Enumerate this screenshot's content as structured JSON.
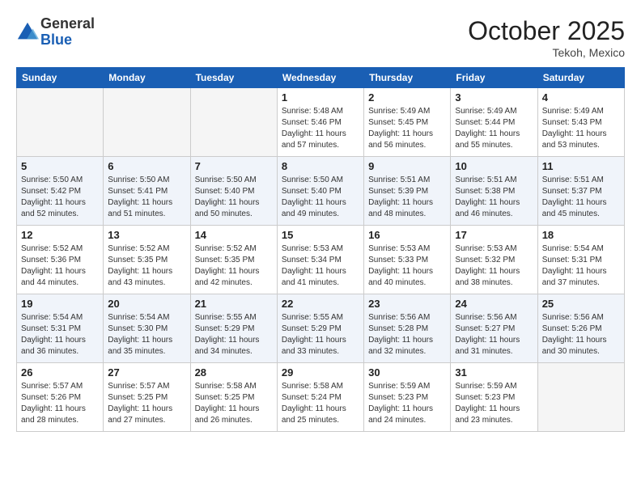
{
  "logo": {
    "general": "General",
    "blue": "Blue"
  },
  "title": "October 2025",
  "location": "Tekoh, Mexico",
  "weekdays": [
    "Sunday",
    "Monday",
    "Tuesday",
    "Wednesday",
    "Thursday",
    "Friday",
    "Saturday"
  ],
  "weeks": [
    [
      {
        "day": null
      },
      {
        "day": null
      },
      {
        "day": null
      },
      {
        "day": 1,
        "sunrise": "Sunrise: 5:48 AM",
        "sunset": "Sunset: 5:46 PM",
        "daylight": "Daylight: 11 hours and 57 minutes."
      },
      {
        "day": 2,
        "sunrise": "Sunrise: 5:49 AM",
        "sunset": "Sunset: 5:45 PM",
        "daylight": "Daylight: 11 hours and 56 minutes."
      },
      {
        "day": 3,
        "sunrise": "Sunrise: 5:49 AM",
        "sunset": "Sunset: 5:44 PM",
        "daylight": "Daylight: 11 hours and 55 minutes."
      },
      {
        "day": 4,
        "sunrise": "Sunrise: 5:49 AM",
        "sunset": "Sunset: 5:43 PM",
        "daylight": "Daylight: 11 hours and 53 minutes."
      }
    ],
    [
      {
        "day": 5,
        "sunrise": "Sunrise: 5:50 AM",
        "sunset": "Sunset: 5:42 PM",
        "daylight": "Daylight: 11 hours and 52 minutes."
      },
      {
        "day": 6,
        "sunrise": "Sunrise: 5:50 AM",
        "sunset": "Sunset: 5:41 PM",
        "daylight": "Daylight: 11 hours and 51 minutes."
      },
      {
        "day": 7,
        "sunrise": "Sunrise: 5:50 AM",
        "sunset": "Sunset: 5:40 PM",
        "daylight": "Daylight: 11 hours and 50 minutes."
      },
      {
        "day": 8,
        "sunrise": "Sunrise: 5:50 AM",
        "sunset": "Sunset: 5:40 PM",
        "daylight": "Daylight: 11 hours and 49 minutes."
      },
      {
        "day": 9,
        "sunrise": "Sunrise: 5:51 AM",
        "sunset": "Sunset: 5:39 PM",
        "daylight": "Daylight: 11 hours and 48 minutes."
      },
      {
        "day": 10,
        "sunrise": "Sunrise: 5:51 AM",
        "sunset": "Sunset: 5:38 PM",
        "daylight": "Daylight: 11 hours and 46 minutes."
      },
      {
        "day": 11,
        "sunrise": "Sunrise: 5:51 AM",
        "sunset": "Sunset: 5:37 PM",
        "daylight": "Daylight: 11 hours and 45 minutes."
      }
    ],
    [
      {
        "day": 12,
        "sunrise": "Sunrise: 5:52 AM",
        "sunset": "Sunset: 5:36 PM",
        "daylight": "Daylight: 11 hours and 44 minutes."
      },
      {
        "day": 13,
        "sunrise": "Sunrise: 5:52 AM",
        "sunset": "Sunset: 5:35 PM",
        "daylight": "Daylight: 11 hours and 43 minutes."
      },
      {
        "day": 14,
        "sunrise": "Sunrise: 5:52 AM",
        "sunset": "Sunset: 5:35 PM",
        "daylight": "Daylight: 11 hours and 42 minutes."
      },
      {
        "day": 15,
        "sunrise": "Sunrise: 5:53 AM",
        "sunset": "Sunset: 5:34 PM",
        "daylight": "Daylight: 11 hours and 41 minutes."
      },
      {
        "day": 16,
        "sunrise": "Sunrise: 5:53 AM",
        "sunset": "Sunset: 5:33 PM",
        "daylight": "Daylight: 11 hours and 40 minutes."
      },
      {
        "day": 17,
        "sunrise": "Sunrise: 5:53 AM",
        "sunset": "Sunset: 5:32 PM",
        "daylight": "Daylight: 11 hours and 38 minutes."
      },
      {
        "day": 18,
        "sunrise": "Sunrise: 5:54 AM",
        "sunset": "Sunset: 5:31 PM",
        "daylight": "Daylight: 11 hours and 37 minutes."
      }
    ],
    [
      {
        "day": 19,
        "sunrise": "Sunrise: 5:54 AM",
        "sunset": "Sunset: 5:31 PM",
        "daylight": "Daylight: 11 hours and 36 minutes."
      },
      {
        "day": 20,
        "sunrise": "Sunrise: 5:54 AM",
        "sunset": "Sunset: 5:30 PM",
        "daylight": "Daylight: 11 hours and 35 minutes."
      },
      {
        "day": 21,
        "sunrise": "Sunrise: 5:55 AM",
        "sunset": "Sunset: 5:29 PM",
        "daylight": "Daylight: 11 hours and 34 minutes."
      },
      {
        "day": 22,
        "sunrise": "Sunrise: 5:55 AM",
        "sunset": "Sunset: 5:29 PM",
        "daylight": "Daylight: 11 hours and 33 minutes."
      },
      {
        "day": 23,
        "sunrise": "Sunrise: 5:56 AM",
        "sunset": "Sunset: 5:28 PM",
        "daylight": "Daylight: 11 hours and 32 minutes."
      },
      {
        "day": 24,
        "sunrise": "Sunrise: 5:56 AM",
        "sunset": "Sunset: 5:27 PM",
        "daylight": "Daylight: 11 hours and 31 minutes."
      },
      {
        "day": 25,
        "sunrise": "Sunrise: 5:56 AM",
        "sunset": "Sunset: 5:26 PM",
        "daylight": "Daylight: 11 hours and 30 minutes."
      }
    ],
    [
      {
        "day": 26,
        "sunrise": "Sunrise: 5:57 AM",
        "sunset": "Sunset: 5:26 PM",
        "daylight": "Daylight: 11 hours and 28 minutes."
      },
      {
        "day": 27,
        "sunrise": "Sunrise: 5:57 AM",
        "sunset": "Sunset: 5:25 PM",
        "daylight": "Daylight: 11 hours and 27 minutes."
      },
      {
        "day": 28,
        "sunrise": "Sunrise: 5:58 AM",
        "sunset": "Sunset: 5:25 PM",
        "daylight": "Daylight: 11 hours and 26 minutes."
      },
      {
        "day": 29,
        "sunrise": "Sunrise: 5:58 AM",
        "sunset": "Sunset: 5:24 PM",
        "daylight": "Daylight: 11 hours and 25 minutes."
      },
      {
        "day": 30,
        "sunrise": "Sunrise: 5:59 AM",
        "sunset": "Sunset: 5:23 PM",
        "daylight": "Daylight: 11 hours and 24 minutes."
      },
      {
        "day": 31,
        "sunrise": "Sunrise: 5:59 AM",
        "sunset": "Sunset: 5:23 PM",
        "daylight": "Daylight: 11 hours and 23 minutes."
      },
      {
        "day": null
      }
    ]
  ]
}
